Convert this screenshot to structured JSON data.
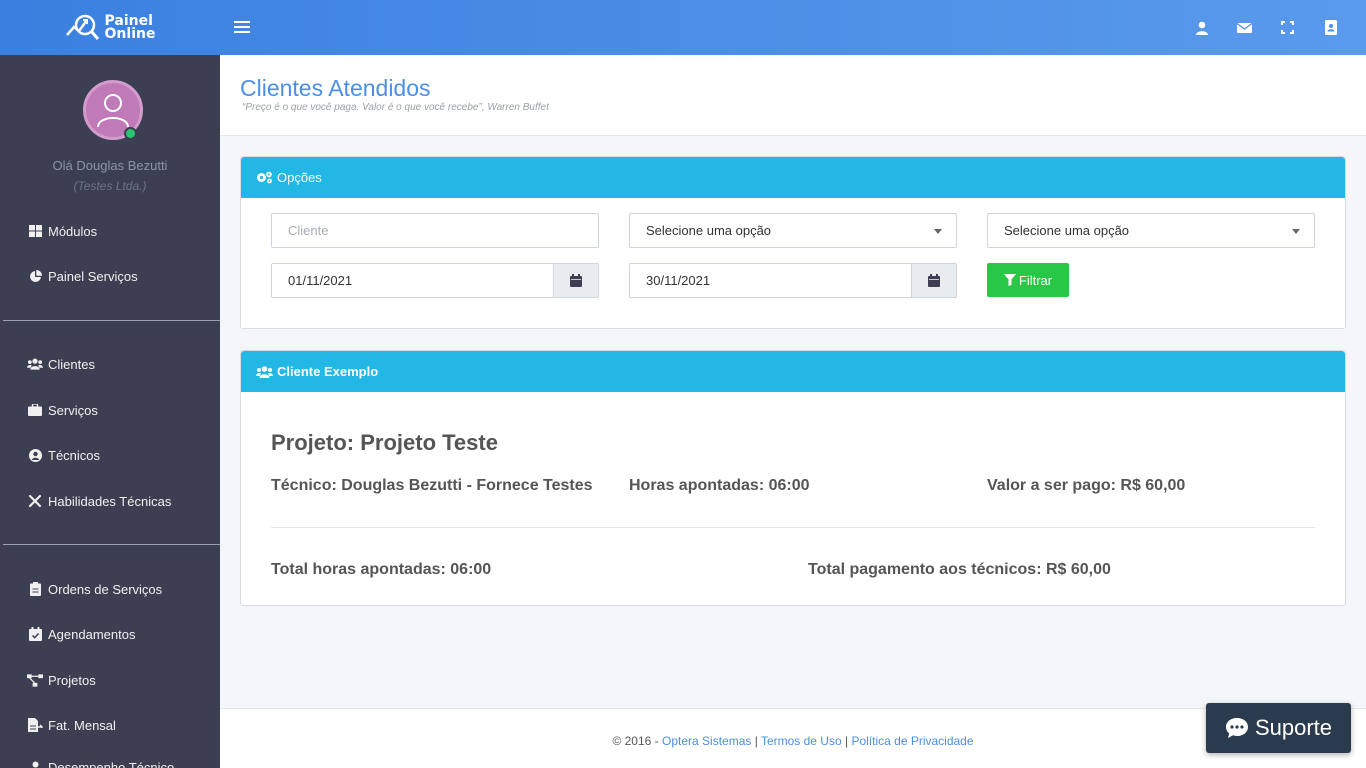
{
  "brand": {
    "line1": "Painel",
    "line2": "Online"
  },
  "user": {
    "greeting": "Olá Douglas Bezutti",
    "company": "(Testes Ltda.)"
  },
  "sidebar": {
    "items": [
      {
        "label": "Módulos",
        "icon": "grid-icon"
      },
      {
        "label": "Painel Serviços",
        "icon": "pie-chart-icon"
      },
      {
        "label": "Clientes",
        "icon": "users-icon"
      },
      {
        "label": "Serviços",
        "icon": "briefcase-icon"
      },
      {
        "label": "Técnicos",
        "icon": "user-circle-icon"
      },
      {
        "label": "Habilidades Técnicas",
        "icon": "tools-icon"
      },
      {
        "label": "Ordens de Serviços",
        "icon": "clipboard-icon"
      },
      {
        "label": "Agendamentos",
        "icon": "calendar-check-icon"
      },
      {
        "label": "Projetos",
        "icon": "project-diagram-icon"
      },
      {
        "label": "Fat. Mensal",
        "icon": "file-invoice-icon"
      },
      {
        "label": "Desempenho Técnico",
        "icon": "user-chart-icon"
      }
    ]
  },
  "page": {
    "title": "Clientes Atendidos",
    "quote": "“Preço é o que você paga. Valor é o que você recebe”, Warren Buffet"
  },
  "options_card": {
    "header": "Opções",
    "client_placeholder": "Cliente",
    "select1": "Selecione uma opção",
    "select2": "Selecione uma opção",
    "date_start": "01/11/2021",
    "date_end": "30/11/2021",
    "filter_label": "Filtrar"
  },
  "client_card": {
    "header": "Cliente Exemplo",
    "project": "Projeto: Projeto Teste",
    "technician": "Técnico: Douglas Bezutti - Fornece Testes",
    "hours": "Horas apontadas: 06:00",
    "value": "Valor a ser pago: R$ 60,00",
    "total_hours": "Total horas apontadas: 06:00",
    "total_payment": "Total pagamento aos técnicos: R$ 60,00"
  },
  "footer": {
    "copyright": "© 2016 - ",
    "company_link": "Optera Sistemas",
    "terms_link": "Termos de Uso",
    "privacy_link": "Política de Privacidade",
    "sep": " | "
  },
  "support": {
    "label": "Suporte"
  },
  "colors": {
    "topbar": "#3a80e0",
    "sidebar": "#3b3f51",
    "card_header": "#22b7e4",
    "filter_button": "#28c745",
    "title": "#4c8fe6",
    "support": "#2b3b4e"
  }
}
